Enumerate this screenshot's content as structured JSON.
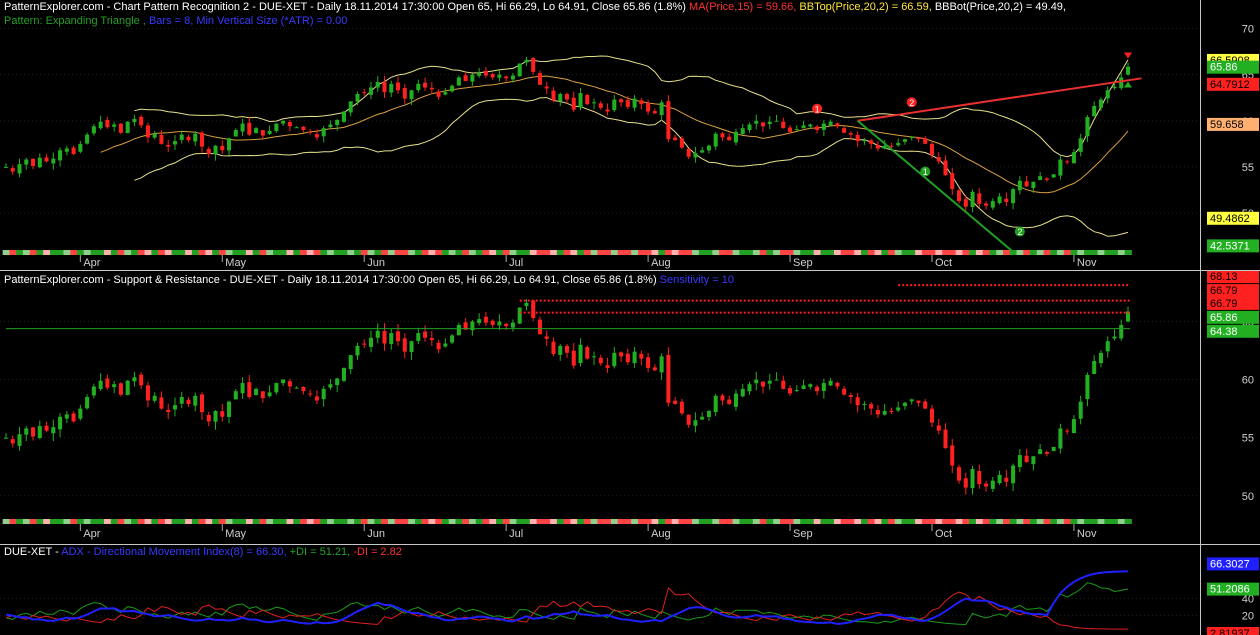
{
  "colors": {
    "up": "#22b022",
    "down": "#ff2020",
    "ma": "#d8a040",
    "bb": "#e8e08a",
    "adx": "#2020ff",
    "pdi": "#1a9a1a",
    "mdi": "#e02020",
    "trend_up": "#e83030",
    "trend_down": "#20a020",
    "resist": "#ff2020",
    "support": "#20a020"
  },
  "months": [
    "Apr",
    "May",
    "Jun",
    "Jul",
    "Aug",
    "Sep",
    "Oct",
    "Nov"
  ],
  "pane1": {
    "header_line1": [
      {
        "text": "PatternExplorer.com - Chart Pattern Recognition 2 - DUE-XET - Daily 18.11.2014 17:30:00 Open 65, Hi 66.29, Lo 64.91, Close 65.86 (1.8%) ",
        "color": "white"
      },
      {
        "text": "MA(Price,15) = 59.66, ",
        "color": "red"
      },
      {
        "text": "BBTop(Price,20,2) = 66.59, ",
        "color": "yellow"
      },
      {
        "text": "BBBot(Price,20,2) = 49.49,",
        "color": "white"
      }
    ],
    "header_line2": [
      {
        "text": "Pattern: Expanding Triangle , ",
        "color": "green"
      },
      {
        "text": "Bars = 8, Min Vertical Size (*ATR) = 0.00",
        "color": "blue"
      }
    ],
    "yticks": [
      "70",
      "65",
      "60",
      "55",
      "50"
    ],
    "tags": [
      {
        "text": "66.5908",
        "bg": "#ffff40",
        "fg": "#000"
      },
      {
        "text": "65.86",
        "bg": "#22b022",
        "fg": "#fff"
      },
      {
        "text": "64.7912",
        "bg": "#ff2020",
        "fg": "#000"
      },
      {
        "text": "59.658",
        "bg": "#ffb070",
        "fg": "#000"
      },
      {
        "text": "49.4862",
        "bg": "#ffff40",
        "fg": "#000"
      },
      {
        "text": "42.5371",
        "bg": "#22b022",
        "fg": "#fff"
      }
    ],
    "markers": [
      "1",
      "2",
      "1",
      "2"
    ]
  },
  "pane2": {
    "header": [
      {
        "text": "PatternExplorer.com - Support & Resistance - DUE-XET - Daily 18.11.2014 17:30:00 Open 65, Hi 66.29, Lo 64.91, Close 65.86 (1.8%) ",
        "color": "white"
      },
      {
        "text": "Sensitivity = 10",
        "color": "blue"
      }
    ],
    "yticks": [
      "65",
      "60",
      "55",
      "50"
    ],
    "tags": [
      {
        "text": "68.13",
        "bg": "#ff2020",
        "fg": "#000"
      },
      {
        "text": "66.79",
        "bg": "#ff2020",
        "fg": "#000"
      },
      {
        "text": "66.79",
        "bg": "#ff2020",
        "fg": "#000"
      },
      {
        "text": "65.86",
        "bg": "#22b022",
        "fg": "#fff"
      },
      {
        "text": "64.38",
        "bg": "#22b022",
        "fg": "#fff"
      }
    ]
  },
  "pane3": {
    "header": [
      {
        "text": "DUE-XET - ",
        "color": "white"
      },
      {
        "text": "ADX - Directional Movement Index(8) = 66.30, ",
        "color": "blue"
      },
      {
        "text": "+DI = 51.21, ",
        "color": "green"
      },
      {
        "text": "-DI = 2.82",
        "color": "red"
      }
    ],
    "yticks": [
      "40",
      "20"
    ],
    "tags": [
      {
        "text": "66.3027",
        "bg": "#2020ff",
        "fg": "#fff"
      },
      {
        "text": "51.2086",
        "bg": "#22b022",
        "fg": "#fff"
      },
      {
        "text": "2.81937",
        "bg": "#ff2020",
        "fg": "#000"
      }
    ]
  },
  "chart_data": {
    "type": "candlestick",
    "symbol": "DUE-XET",
    "period": "Daily",
    "last_bar": {
      "date": "18.11.2014 17:30:00",
      "open": 65,
      "high": 66.29,
      "low": 64.91,
      "close": 65.86,
      "change_pct": 1.8
    },
    "indicators": {
      "ma15": 59.66,
      "bb_top": 66.59,
      "bb_bot": 49.49,
      "adx": 66.3,
      "plus_di": 51.21,
      "minus_di": 2.82
    },
    "pattern": {
      "name": "Expanding Triangle",
      "bars": 8,
      "min_vertical_size_atr": 0.0
    },
    "sensitivity": 10,
    "ylim_price": [
      46,
      72
    ],
    "ylim_price_sr": [
      48,
      69
    ],
    "close_series": [
      55.0,
      54.5,
      55.3,
      55.8,
      55.1,
      56.0,
      55.6,
      55.9,
      56.8,
      57.0,
      56.4,
      57.5,
      58.5,
      59.4,
      59.9,
      59.3,
      59.6,
      58.7,
      59.9,
      60.2,
      59.5,
      58.2,
      58.6,
      57.5,
      57.2,
      57.8,
      58.5,
      57.9,
      58.6,
      57.2,
      56.4,
      57.3,
      56.8,
      58.1,
      59.0,
      59.7,
      58.5,
      59.2,
      58.4,
      58.9,
      59.7,
      60.0,
      59.4,
      59.3,
      59.0,
      58.8,
      58.2,
      59.2,
      59.6,
      60.1,
      61.0,
      62.1,
      62.9,
      63.0,
      63.6,
      64.2,
      63.1,
      64.0,
      63.3,
      62.4,
      63.3,
      64.0,
      63.6,
      63.4,
      62.6,
      63.1,
      63.8,
      64.7,
      64.3,
      65.0,
      65.2,
      64.9,
      64.7,
      65.0,
      64.6,
      64.9,
      66.2,
      66.6,
      65.3,
      63.9,
      63.5,
      62.2,
      62.9,
      62.3,
      61.2,
      63.0,
      61.8,
      62.0,
      61.4,
      61.0,
      62.3,
      62.0,
      61.5,
      62.4,
      61.8,
      61.0,
      60.8,
      62.0,
      58.0,
      57.9,
      57.1,
      56.1,
      56.5,
      56.8,
      57.3,
      58.6,
      58.2,
      57.9,
      58.8,
      59.2,
      59.6,
      60.0,
      59.4,
      59.9,
      60.0,
      59.2,
      58.8,
      59.1,
      59.5,
      59.6,
      59.0,
      59.7,
      59.9,
      59.4,
      58.7,
      58.5,
      57.8,
      57.9,
      57.5,
      57.0,
      57.3,
      57.2,
      57.6,
      58.0,
      58.3,
      58.0,
      57.5,
      56.3,
      55.6,
      54.1,
      52.6,
      51.3,
      50.7,
      52.3,
      51.0,
      50.8,
      51.3,
      51.8,
      51.2,
      52.6,
      53.5,
      52.9,
      53.4,
      54.0,
      53.6,
      54.2,
      55.8,
      55.6,
      56.6,
      58.1,
      60.4,
      61.6,
      62.3,
      63.3,
      63.7,
      64.7,
      65.86
    ]
  }
}
